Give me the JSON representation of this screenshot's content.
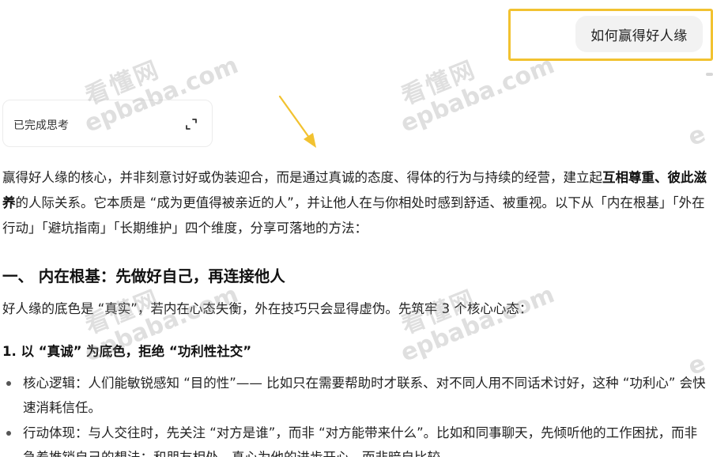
{
  "question": "如何赢得好人缘",
  "thinking": {
    "label": "已完成思考"
  },
  "icons": {
    "expand": "expand-icon",
    "arrow": "arrow-annotation-icon"
  },
  "colors": {
    "highlight": "#f2c230",
    "arrow": "#f2c230",
    "bubble": "#f2f2f2"
  },
  "watermark": {
    "cn": "看懂网",
    "en": "epbaba.com",
    "en_partial": "e"
  },
  "intro": {
    "part1": "赢得好人缘的核心，并非刻意讨好或伪装迎合，而是通过真诚的态度、得体的行为与持续的经营，建立起",
    "bold1": "互相尊重、彼此滋养",
    "part2": "的人际关系。它本质是 “成为更值得被亲近的人”，并让他人在与你相处时感到舒适、被重视。以下从「内在根基」「外在行动」「避坑指南」「长期维护」四个维度，分享可落地的方法："
  },
  "section1": {
    "heading": "一、 内在根基：先做好自己，再连接他人",
    "text": "好人缘的底色是 “真实”，若内在心态失衡，外在技巧只会显得虚伪。先筑牢 3 个核心心态："
  },
  "sub1": {
    "heading": "1. 以 “真诚” 为底色，拒绝 “功利性社交”"
  },
  "bullets": [
    "核心逻辑：人们能敏锐感知 “目的性”—— 比如只在需要帮助时才联系、对不同人用不同话术讨好，这种 “功利心” 会快速消耗信任。",
    "行动体现：与人交往时，先关注 “对方是谁”，而非 “对方能带来什么”。比如和同事聊天，先倾听他的工作困扰，而非急着推销自己的想法；和朋友相处，真心为他的进步开心，而非暗自比较。"
  ]
}
